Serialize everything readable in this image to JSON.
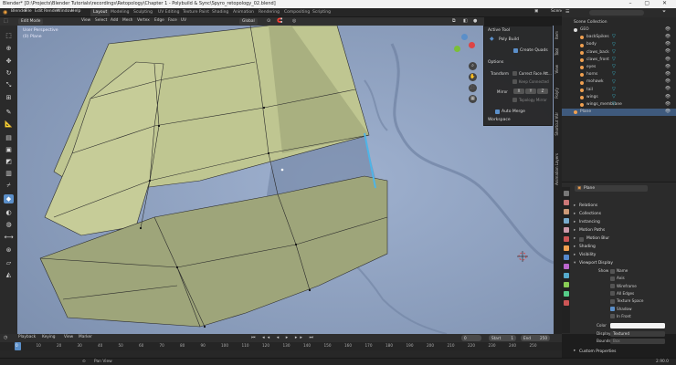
{
  "window": {
    "title": "Blender* [D:\\Projects\\Blender Tutorials\\recordings\\Retopology\\Chapter 1 - Polybuild & Sync\\Spyro_retopology_02.blend]"
  },
  "menus": [
    "Blender",
    "File",
    "Edit",
    "Render",
    "Window",
    "Help"
  ],
  "workspaces": [
    "Layout",
    "Modeling",
    "Sculpting",
    "UV Editing",
    "Texture Paint",
    "Shading",
    "Animation",
    "Rendering",
    "Compositing",
    "Scripting"
  ],
  "scene": {
    "name": "Scene",
    "view_layer": "View Layer"
  },
  "viewport_header": {
    "mode": "Edit Mode",
    "menus": [
      "View",
      "Select",
      "Add",
      "Mesh",
      "Vertex",
      "Edge",
      "Face",
      "UV"
    ],
    "orientation": "Global"
  },
  "viewport": {
    "view_name": "User Perspective",
    "object_label": "(0) Plane"
  },
  "npanel": {
    "active_tool": "Active Tool",
    "tool_name": "Poly Build",
    "create_quads": "Create Quads",
    "options": "Options",
    "transform_label": "Transform",
    "correct_face": "Correct Face Att...",
    "keep_connected": "Keep Connected",
    "mirror_label": "Mirror",
    "mirror_axes": [
      "X",
      "Y",
      "Z"
    ],
    "topology_mirror": "Topology Mirror",
    "auto_merge": "Auto Merge",
    "workspace": "Workspace",
    "tabs": [
      "Item",
      "Tool",
      "View",
      "Polyfy",
      "Shortcut VUr",
      "Animation Layers"
    ]
  },
  "outliner": {
    "header": "Scene Collection",
    "rows": [
      {
        "name": "Scene Collection",
        "indent": 0,
        "sel": false
      },
      {
        "name": "GEO",
        "indent": 1,
        "sel": false
      },
      {
        "name": "backSpikes",
        "indent": 2,
        "sel": false
      },
      {
        "name": "body",
        "indent": 2,
        "sel": false
      },
      {
        "name": "claws_back",
        "indent": 2,
        "sel": false
      },
      {
        "name": "claws_front",
        "indent": 2,
        "sel": false
      },
      {
        "name": "eyes",
        "indent": 2,
        "sel": false
      },
      {
        "name": "horns",
        "indent": 2,
        "sel": false
      },
      {
        "name": "mohawk",
        "indent": 2,
        "sel": false
      },
      {
        "name": "tail",
        "indent": 2,
        "sel": false
      },
      {
        "name": "wings",
        "indent": 2,
        "sel": false
      },
      {
        "name": "wings_membrane",
        "indent": 2,
        "sel": false
      },
      {
        "name": "Plane",
        "indent": 1,
        "sel": true
      }
    ]
  },
  "properties": {
    "object_name": "Plane",
    "sections": [
      "Relations",
      "Collections",
      "Instancing",
      "Motion Paths",
      "Motion Blur",
      "Shading",
      "Visibility",
      "Viewport Display"
    ],
    "viewport_display": {
      "show_label": "Show",
      "options": [
        {
          "label": "Name",
          "on": false
        },
        {
          "label": "Axis",
          "on": false
        },
        {
          "label": "Wireframe",
          "on": false
        },
        {
          "label": "All Edges",
          "on": false
        },
        {
          "label": "Texture Space",
          "on": false
        },
        {
          "label": "Shadow",
          "on": true
        },
        {
          "label": "In Front",
          "on": false
        }
      ],
      "color_label": "Color",
      "display_as_label": "Display As",
      "display_as_value": "Textured",
      "bounds_label": "Bounds",
      "bounds_value": "Box"
    },
    "custom_props": "Custom Properties"
  },
  "timeline": {
    "menus": [
      "Playback",
      "Keying",
      "View",
      "Marker"
    ],
    "current_frame": "0",
    "start_label": "Start",
    "start": "1",
    "end_label": "End",
    "end": "250",
    "ticks": [
      "0",
      "10",
      "20",
      "30",
      "40",
      "50",
      "60",
      "70",
      "80",
      "90",
      "100",
      "110",
      "120",
      "130",
      "140",
      "150",
      "160",
      "170",
      "180",
      "190",
      "200",
      "210",
      "220",
      "230",
      "240",
      "250"
    ]
  },
  "status": {
    "left": "Pan View",
    "right": "2.90.0"
  },
  "colors": {
    "mesh_face": "#bfc691",
    "mesh_shade": "#9ea57a",
    "model": "#8ea1c0",
    "accent": "#5b8fc9"
  }
}
